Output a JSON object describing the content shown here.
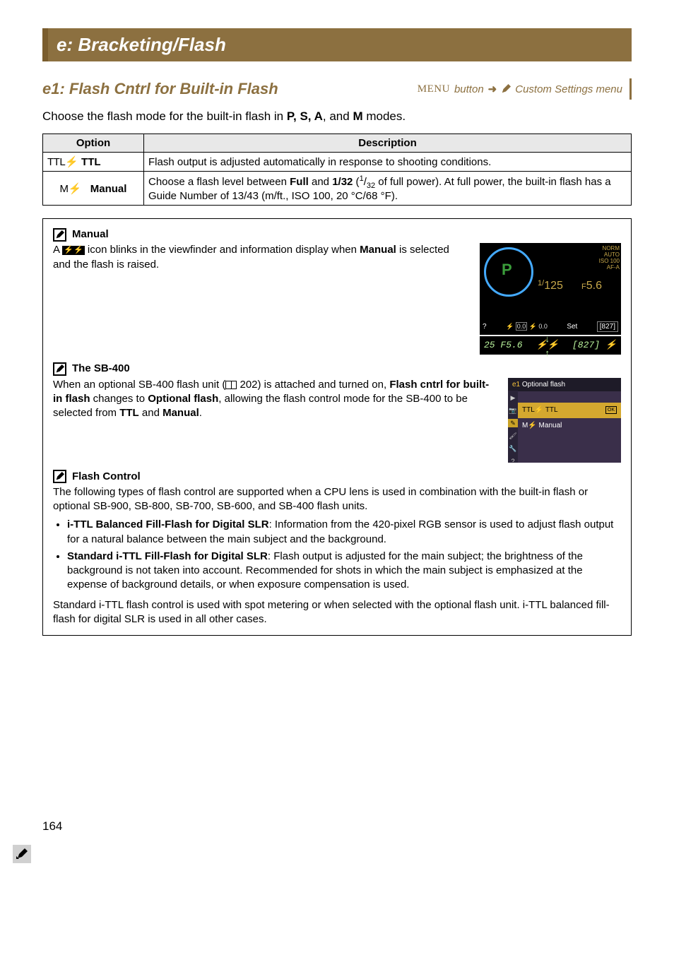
{
  "section": {
    "title": "e: Bracketing/Flash"
  },
  "setting": {
    "title": "e1: Flash Cntrl for Built-in Flash",
    "menu_text": "MENU",
    "button_text": "button",
    "arrow": "➜",
    "menu_path": "Custom Settings menu"
  },
  "intro": {
    "prefix": "Choose the flash mode for the built-in flash in ",
    "modes": "P, S, A",
    "and": ", and ",
    "mode_m": "M",
    "suffix": " modes."
  },
  "table": {
    "headers": {
      "option": "Option",
      "description": "Description"
    },
    "rows": [
      {
        "opt_prefix": "TTL",
        "opt_bolt": "⚡",
        "opt_label": "TTL",
        "opt_label_bold": true,
        "desc": "Flash output is adjusted automatically in response to shooting conditions."
      },
      {
        "opt_prefix": "M",
        "opt_bolt": "⚡",
        "opt_label": "Manual",
        "opt_label_bold": true,
        "desc_1": "Choose a flash level between ",
        "desc_full": "Full",
        "desc_2": " and ",
        "desc_frac": "1/32",
        "desc_3": " (",
        "desc_fn": "1",
        "desc_slash": "/",
        "desc_fd": "32",
        "desc_4": " of full power).  At full power, the built-in flash has a Guide Number of 13/43 (m/ft., ISO 100, 20 °C/68 °F)."
      }
    ]
  },
  "note_manual": {
    "title": "Manual",
    "t1": "A ",
    "glyph": "⚡⚡",
    "t2": " icon blinks in the viewfinder and information display when ",
    "bold": "Manual",
    "t3": " is selected and the flash is raised."
  },
  "note_sb400": {
    "title": "The SB-400",
    "t1": "When an optional SB-400 flash unit (",
    "page": " 202) is attached and turned on, ",
    "b1": "Flash cntrl for built-in flash",
    "t2": " changes to ",
    "b2": "Optional flash",
    "t3": ", allowing the flash control mode for the SB-400 to be selected from ",
    "b3": "TTL",
    "t4": " and ",
    "b4": "Manual",
    "t5": "."
  },
  "note_flashctrl": {
    "title": "Flash Control",
    "p1": "The following types of flash control are supported when a CPU lens is used in combination with the built-in flash or optional SB-900, SB-800, SB-700, SB-600, and SB-400 flash units.",
    "li1_b": "i-TTL Balanced Fill-Flash for Digital SLR",
    "li1_t": ": Information from the 420-pixel RGB sensor is used to adjust flash output for a natural balance between the main subject and the background.",
    "li2_b": "Standard i-TTL Fill-Flash for Digital SLR",
    "li2_t": ": Flash output is adjusted for the main subject; the brightness of the background is not taken into account.  Recommended for shots in which the main subject is emphasized at the expense of background details, or when exposure compensation is used.",
    "p2": "Standard i-TTL flash control is used with spot metering or when selected with the optional flash unit.  i-TTL balanced fill-flash for digital SLR is used in all other cases."
  },
  "cam": {
    "shutter_pre": "1/",
    "shutter_val": "125",
    "ap_pre": "F",
    "ap_val": "5.6",
    "right_lines": "NORM\nAUTO\nISO 100\nAF-A",
    "set_label": "Set",
    "count": "[827]"
  },
  "vf": {
    "left": "25  F5.6",
    "right": "[827] ⚡"
  },
  "menu_scr": {
    "ecode": "e1",
    "title": "Optional flash",
    "row1": "TTL⚡ TTL",
    "ok": "OK",
    "row2": "M⚡  Manual"
  },
  "page_number": "164"
}
